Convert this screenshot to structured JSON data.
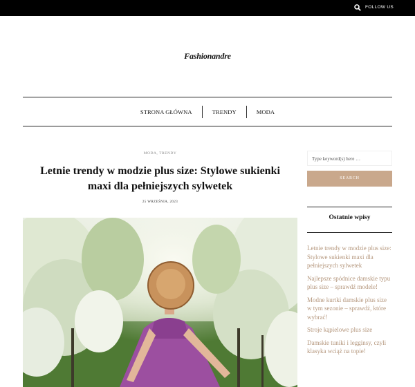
{
  "topbar": {
    "search_icon": "search-icon",
    "follow_label": "FOLLOW US"
  },
  "site": {
    "logo": "Fashionandre"
  },
  "nav": {
    "items": [
      "STRONA GŁÓWNA",
      "TRENDY",
      "MODA"
    ]
  },
  "article": {
    "categories": "MODA, TRENDY",
    "title": "Letnie trendy w modzie plus size: Stylowe sukienki maxi dla pełniejszych sylwetek",
    "date": "25 WRZEŚNIA, 2023"
  },
  "sidebar": {
    "search_placeholder": "Type keyword(s) here …",
    "search_button": "SEARCH",
    "recent_title": "Ostatnie wpisy",
    "recent_posts": [
      "Letnie trendy w modzie plus size: Stylowe sukienki maxi dla pełniejszych sylwetek",
      "Najlepsze spódnice damskie typu plus size – sprawdź modele!",
      "Modne kurtki damskie plus size w tym sezonie – sprawdź, które wybrać!",
      "Stroje kąpielowe plus size",
      "Damskie tuniki i legginsy, czyli klasyka wciąż na topie!"
    ]
  },
  "colors": {
    "accent": "#c9a88c",
    "link": "#b4967c",
    "topbar": "#000000"
  }
}
